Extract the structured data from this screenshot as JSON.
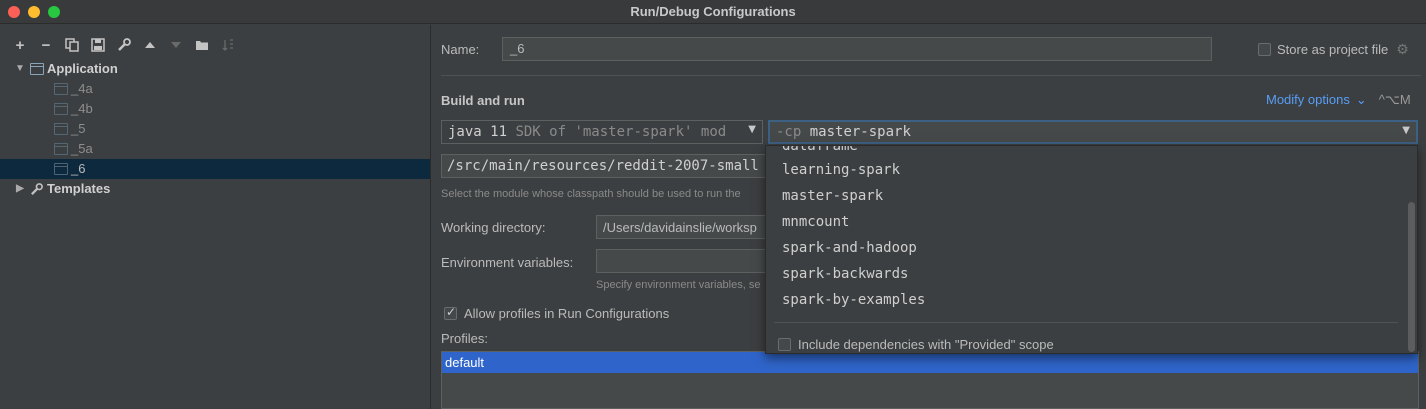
{
  "window": {
    "title": "Run/Debug Configurations"
  },
  "toolbar": {
    "icons": [
      "add-icon",
      "remove-icon",
      "copy-icon",
      "save-icon",
      "wrench-icon",
      "arrow-up-icon",
      "arrow-down-icon",
      "folder-icon",
      "sort-icon"
    ],
    "add": "+",
    "remove": "−"
  },
  "tree": {
    "application": "Application",
    "children": [
      "_4a",
      "_4b",
      "_5",
      "_5a",
      "_6"
    ],
    "selected": "_6",
    "templates": "Templates"
  },
  "form": {
    "name_label": "Name:",
    "name_value": "_6",
    "store_label": "Store as project file",
    "section_title": "Build and run",
    "modify_options": "Modify options",
    "modify_shortcut": "^⌥M",
    "jre_value": "java 11",
    "jre_hint": "SDK of 'master-spark' mod",
    "cp_prefix": "-cp",
    "cp_value": "master-spark",
    "main_class_value": "/src/main/resources/reddit-2007-small",
    "module_hint": "Select the module whose classpath should be used to run the",
    "working_dir_label": "Working directory:",
    "working_dir_value": "/Users/davidainslie/worksp",
    "env_label": "Environment variables:",
    "env_hint": "Specify environment variables, se",
    "allow_profiles_label": "Allow profiles in Run Configurations",
    "profiles_label": "Profiles:",
    "profiles": [
      "default"
    ]
  },
  "dropdown": {
    "partial_top": "dataframe",
    "options": [
      "learning-spark",
      "master-spark",
      "mnmcount",
      "spark-and-hadoop",
      "spark-backwards",
      "spark-by-examples"
    ],
    "include_label": "Include dependencies with \"Provided\" scope"
  }
}
